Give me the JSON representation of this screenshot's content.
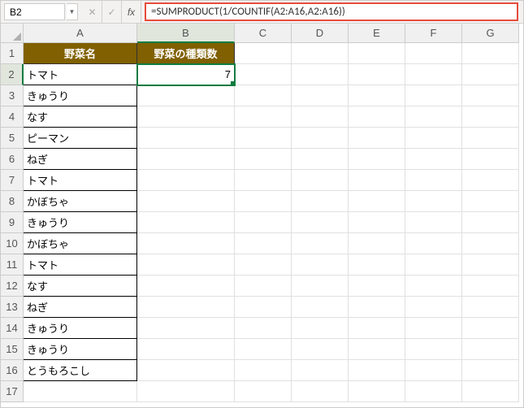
{
  "nameBox": "B2",
  "formula": "=SUMPRODUCT(1/COUNTIF(A2:A16,A2:A16))",
  "columns": [
    "A",
    "B",
    "C",
    "D",
    "E",
    "F",
    "G"
  ],
  "rowNumbers": [
    "1",
    "2",
    "3",
    "4",
    "5",
    "6",
    "7",
    "8",
    "9",
    "10",
    "11",
    "12",
    "13",
    "14",
    "15",
    "16",
    "17"
  ],
  "headers": {
    "a": "野菜名",
    "b": "野菜の種類数"
  },
  "activeValue": "7",
  "colA": [
    "トマト",
    "きゅうり",
    "なす",
    "ピーマン",
    "ねぎ",
    "トマト",
    "かぼちゃ",
    "きゅうり",
    "かぼちゃ",
    "トマト",
    "なす",
    "ねぎ",
    "きゅうり",
    "きゅうり",
    "とうもろこし"
  ],
  "chart_data": {
    "type": "table",
    "title": "野菜の種類数",
    "columns": [
      "野菜名",
      "野菜の種類数"
    ],
    "rows": [
      [
        "トマト",
        7
      ],
      [
        "きゅうり",
        null
      ],
      [
        "なす",
        null
      ],
      [
        "ピーマン",
        null
      ],
      [
        "ねぎ",
        null
      ],
      [
        "トマト",
        null
      ],
      [
        "かぼちゃ",
        null
      ],
      [
        "きゅうり",
        null
      ],
      [
        "かぼちゃ",
        null
      ],
      [
        "トマト",
        null
      ],
      [
        "なす",
        null
      ],
      [
        "ねぎ",
        null
      ],
      [
        "きゅうり",
        null
      ],
      [
        "きゅうり",
        null
      ],
      [
        "とうもろこし",
        null
      ]
    ],
    "formula": "=SUMPRODUCT(1/COUNTIF(A2:A16,A2:A16))"
  }
}
